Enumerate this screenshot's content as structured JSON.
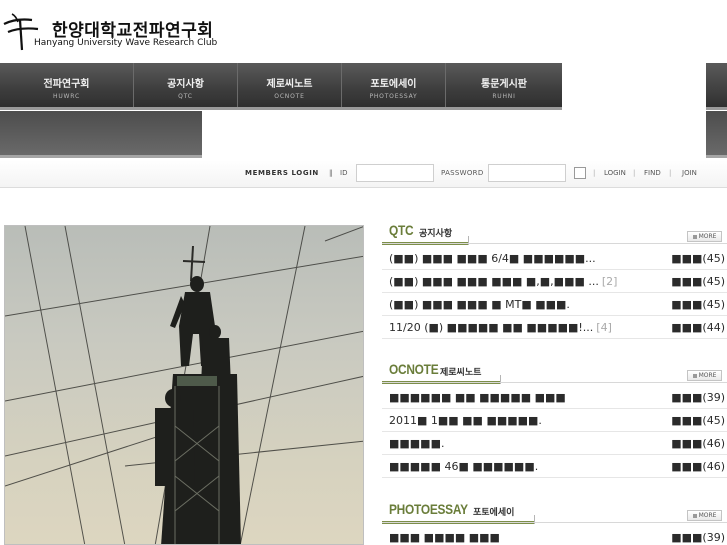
{
  "logo": {
    "korean": "한양대학교전파연구회",
    "english": "Hanyang University Wave Research Club"
  },
  "nav": {
    "items": [
      {
        "kr": "전파연구회",
        "en": "HUWRC"
      },
      {
        "kr": "공지사항",
        "en": "QTC"
      },
      {
        "kr": "제로씨노트",
        "en": "OCNOTE"
      },
      {
        "kr": "포토에세이",
        "en": "PHOTOESSAY"
      },
      {
        "kr": "통문게시판",
        "en": "RUHNI"
      }
    ]
  },
  "login": {
    "title": "MEMBERS LOGIN",
    "separator": "‖",
    "id_label": "ID",
    "id_value": "",
    "password_label": "PASSWORD",
    "password_value": "",
    "login_label": "LOGIN",
    "find_label": "FIND",
    "join_label": "JOIN",
    "divider": "|"
  },
  "sections": {
    "qtc": {
      "en": "QTC",
      "kr": "공지사항",
      "more": "MORE",
      "items": [
        {
          "title": "(■■) ■■■ ■■■ 6/4■ ■■■■■■...",
          "comments": "",
          "meta": "■■■(45)"
        },
        {
          "title": "(■■) ■■■ ■■■ ■■■ ■,■,■■■ ...",
          "comments": "[2]",
          "meta": "■■■(45)"
        },
        {
          "title": "(■■) ■■■ ■■■ ■ MT■ ■■■.",
          "comments": "",
          "meta": "■■■(45)"
        },
        {
          "title": "11/20 (■) ■■■■■ ■■ ■■■■■!...",
          "comments": "[4]",
          "meta": "■■■(44)"
        }
      ]
    },
    "ocnote": {
      "en": "OCNOTE",
      "kr": "제로씨노트",
      "more": "MORE",
      "items": [
        {
          "title": "■■■■■■ ■■ ■■■■■ ■■■",
          "comments": "",
          "meta": "■■■(39)"
        },
        {
          "title": "2011■ 1■■ ■■ ■■■■■.",
          "comments": "",
          "meta": "■■■(45)"
        },
        {
          "title": "■■■■■.",
          "comments": "",
          "meta": "■■■(46)"
        },
        {
          "title": "■■■■■ 46■ ■■■■■■.",
          "comments": "",
          "meta": "■■■(46)"
        }
      ]
    },
    "photoessay": {
      "en": "PHOTOESSAY",
      "kr": "포토에세이",
      "more": "MORE",
      "items": [
        {
          "title": "■■■ ■■■■ ■■■",
          "comments": "",
          "meta": "■■■(39)"
        }
      ]
    }
  },
  "colors": {
    "nav_bg": "#3c3c3c",
    "section_accent": "#7d8f4a",
    "section_title": "#6a7d3a"
  },
  "icons": [
    "logo-mark-icon",
    "checkbox-icon",
    "more-dot-icon"
  ]
}
